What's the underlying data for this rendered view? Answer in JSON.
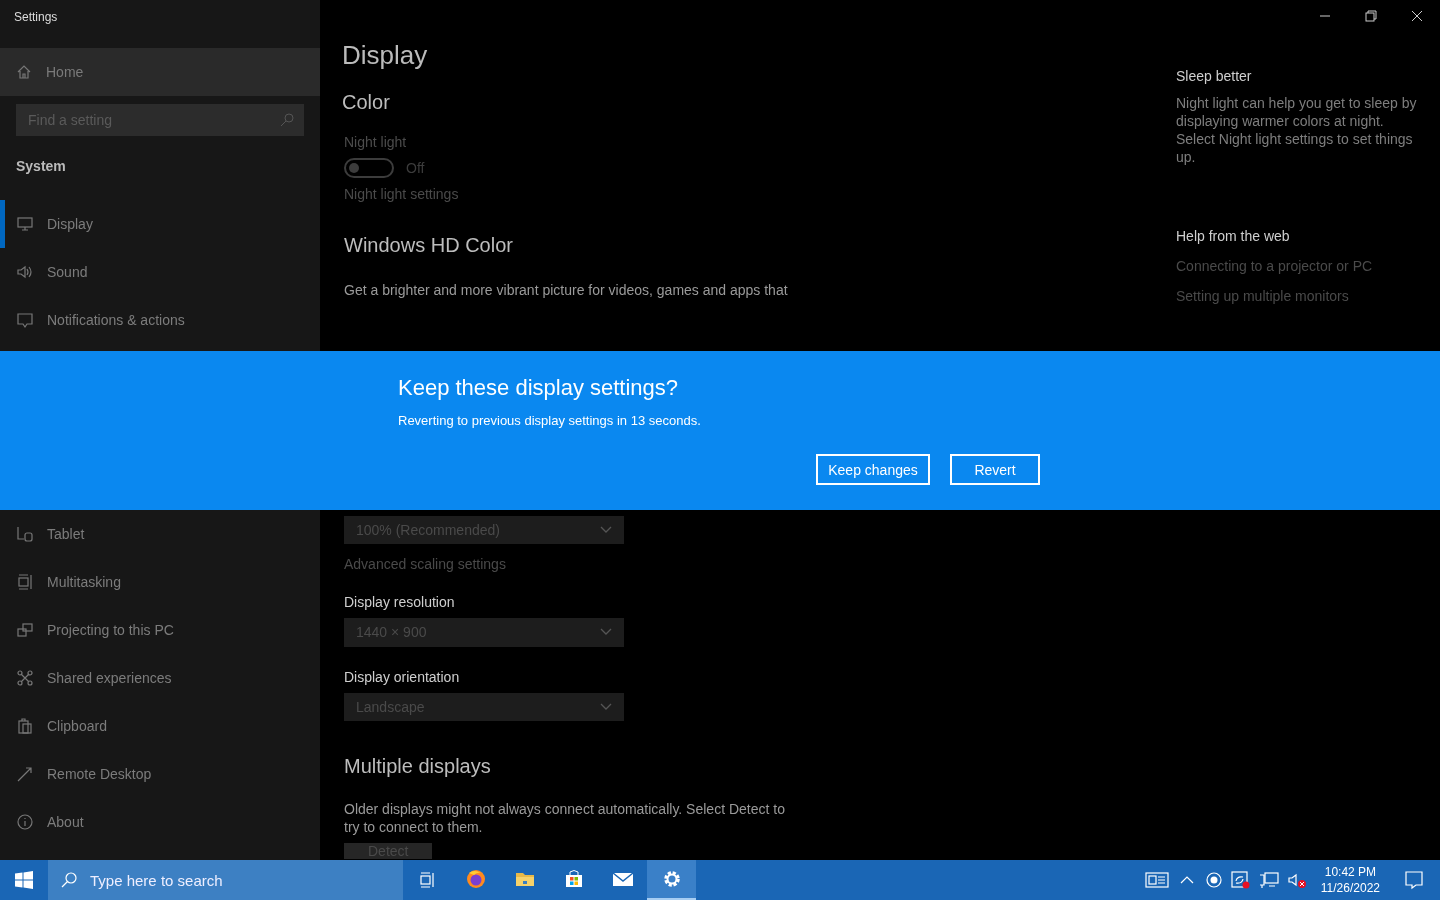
{
  "window": {
    "title": "Settings"
  },
  "sidebar": {
    "home": "Home",
    "search": {
      "placeholder": "Find a setting"
    },
    "section": "System",
    "items": [
      {
        "label": "Display",
        "selected": true
      },
      {
        "label": "Sound",
        "selected": false
      },
      {
        "label": "Notifications & actions",
        "selected": false
      },
      {
        "label": "Tablet",
        "selected": false
      },
      {
        "label": "Multitasking",
        "selected": false
      },
      {
        "label": "Projecting to this PC",
        "selected": false
      },
      {
        "label": "Shared experiences",
        "selected": false
      },
      {
        "label": "Clipboard",
        "selected": false
      },
      {
        "label": "Remote Desktop",
        "selected": false
      },
      {
        "label": "About",
        "selected": false
      }
    ]
  },
  "main": {
    "title": "Display",
    "blocks": [
      {
        "kind": "heading",
        "text": "Color"
      },
      {
        "kind": "caption",
        "text": "Night light"
      },
      {
        "kind": "toggle",
        "on": false,
        "state_label": "Off"
      },
      {
        "kind": "link",
        "text": "Night light settings"
      },
      {
        "kind": "heading",
        "text": "Windows HD Color"
      },
      {
        "kind": "text",
        "text": "Get a brighter and more vibrant picture for videos, games and apps that"
      },
      {
        "kind": "dropdown",
        "value": "100% (Recommended)"
      },
      {
        "kind": "link",
        "text": "Advanced scaling settings"
      },
      {
        "kind": "label",
        "text": "Display resolution"
      },
      {
        "kind": "dropdown",
        "value": "1440 × 900"
      },
      {
        "kind": "label",
        "text": "Display orientation"
      },
      {
        "kind": "dropdown",
        "value": "Landscape"
      },
      {
        "kind": "heading",
        "text": "Multiple displays"
      },
      {
        "kind": "text",
        "text": "Older displays might not always connect automatically. Select Detect to try to connect to them."
      },
      {
        "kind": "button",
        "text": "Detect"
      }
    ]
  },
  "aside": [
    {
      "title": "Sleep better",
      "text": "Night light can help you get to sleep by displaying warmer colors at night. Select Night light settings to set things up."
    },
    {
      "title": "Help from the web",
      "links": [
        "Connecting to a projector or PC",
        "Setting up multiple monitors"
      ]
    }
  ],
  "dialog": {
    "title": "Keep these display settings?",
    "message": "Reverting to previous display settings in 13 seconds.",
    "buttons": [
      "Keep changes",
      "Revert"
    ]
  },
  "taskbar": {
    "search": {
      "placeholder": "Type here to search"
    },
    "apps": [
      {
        "active": false
      },
      {
        "active": false
      },
      {
        "active": false
      },
      {
        "active": false
      },
      {
        "active": true
      }
    ],
    "time": "10:42 PM",
    "date": "11/26/2022"
  }
}
